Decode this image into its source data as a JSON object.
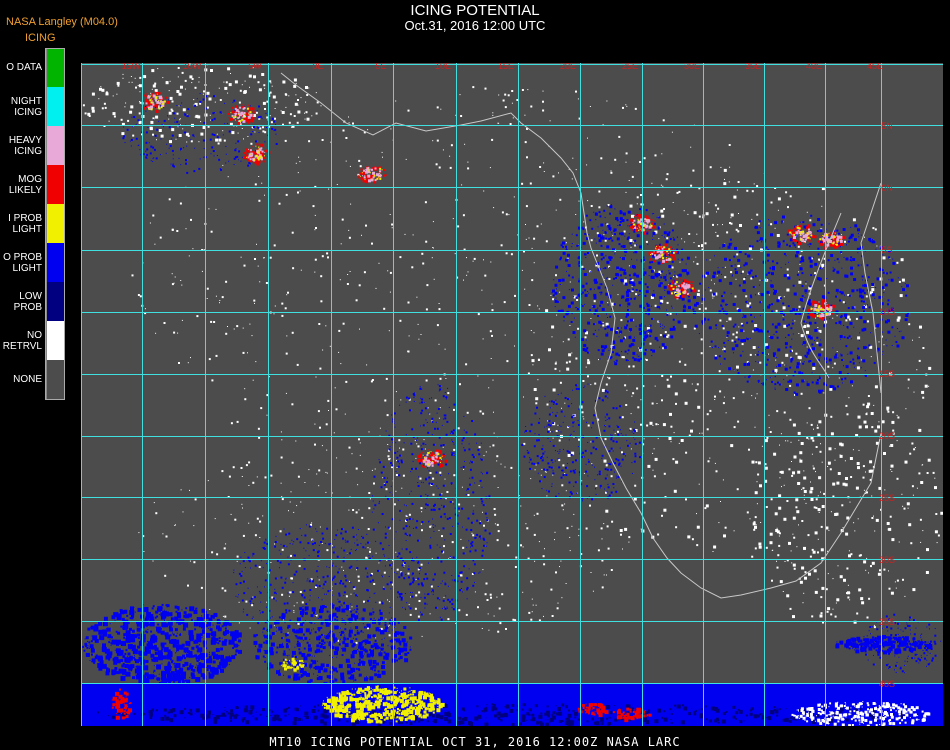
{
  "header": {
    "title": "ICING POTENTIAL",
    "datetime": "Oct.31, 2016 12:00 UTC",
    "source": "NASA Langley (M04.0)",
    "legend_title": "ICING"
  },
  "legend": [
    {
      "label": "O DATA",
      "color": "#00b400"
    },
    {
      "label": "NIGHT\nICING",
      "color": "#00f0f0"
    },
    {
      "label": "HEAVY\nICING",
      "color": "#e8a8d8"
    },
    {
      "label": "MOG\nLIKELY",
      "color": "#f00000"
    },
    {
      "label": "I PROB\nLIGHT",
      "color": "#f0f000"
    },
    {
      "label": "O PROB\nLIGHT",
      "color": "#0000f0"
    },
    {
      "label": "LOW\nPROB",
      "color": "#000080"
    },
    {
      "label": "NO\nRETRVL",
      "color": "#ffffff"
    },
    {
      "label": "NONE",
      "color": "#4c4c4c"
    }
  ],
  "map": {
    "background": "#4c4c4c",
    "grid_color": "#40e0e0",
    "coast_color": "#c8c8c8",
    "label_color": "#d02020",
    "lon_labels": [
      "15W",
      "10W",
      "5W",
      "0E",
      "5E",
      "10E",
      "15E",
      "20E",
      "25E",
      "30E",
      "35E",
      "40E",
      "45E"
    ],
    "lat_labels": [
      "5N",
      "0N",
      "5S",
      "10S",
      "15S",
      "20S",
      "25S",
      "30S",
      "35S",
      "40S"
    ]
  },
  "footer": {
    "caption": "MT10  ICING POTENTIAL   OCT 31, 2016 12:00Z   NASA LARC"
  }
}
